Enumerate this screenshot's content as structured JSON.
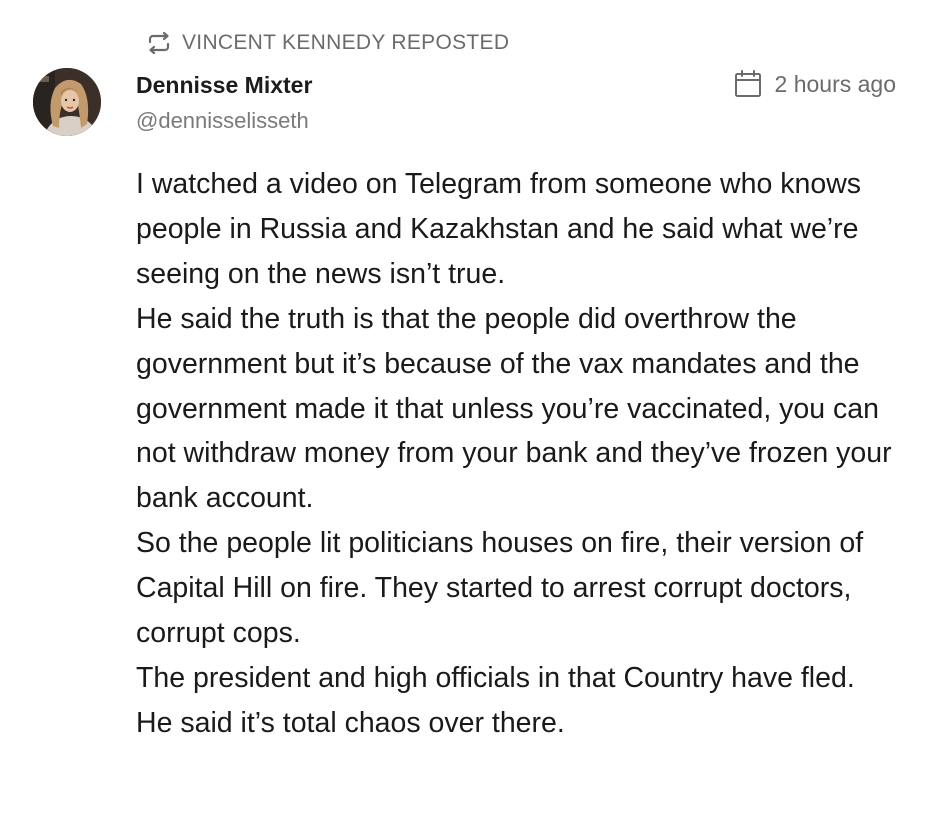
{
  "repost": {
    "label": "VINCENT KENNEDY REPOSTED",
    "icon": "repost-icon"
  },
  "author": {
    "name": "Dennisse Mixter",
    "handle": "@dennisselisseth",
    "avatar_icon": "avatar"
  },
  "timestamp": {
    "text": "2 hours ago",
    "icon": "calendar-icon"
  },
  "post": {
    "paragraphs": [
      "I watched a video on Telegram from someone who knows people in Russia and Kazakhstan and he said what we’re seeing on the news isn’t true.",
      "He said the truth is that the people did overthrow the government but it’s because of the vax mandates and the government made it that unless you’re vaccinated, you can not withdraw money from your bank and they’ve frozen your bank account.",
      "So the people lit politicians houses on fire, their version of Capital Hill on fire. They started to arrest corrupt doctors, corrupt cops.",
      "The president and high officials in that Country have fled.",
      "He said it’s total chaos over there."
    ]
  },
  "colors": {
    "muted_text": "#6b6b6b",
    "body_text": "#1a1a1a",
    "background": "#ffffff"
  }
}
